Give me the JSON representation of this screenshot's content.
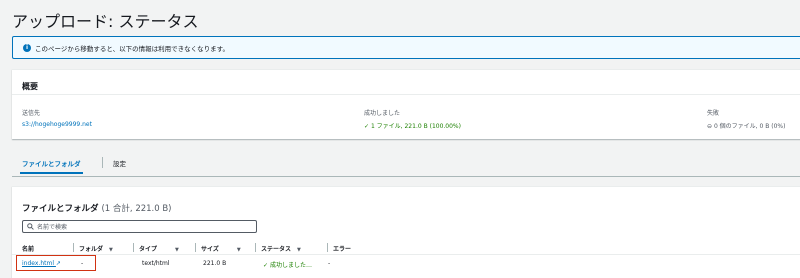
{
  "page": {
    "title": "アップロード: ステータス"
  },
  "info": {
    "message": "このページから移動すると、以下の情報は利用できなくなります。"
  },
  "overview": {
    "heading": "概要",
    "destination": {
      "label": "送信先",
      "value": "s3://hogehoge9999.net"
    },
    "succeeded": {
      "label": "成功しました",
      "value": "1 ファイル, 221.0 B (100.00%)"
    },
    "failed": {
      "label": "失敗",
      "value": "0 個のファイル, 0 B (0%)"
    }
  },
  "tabs": [
    {
      "label": "ファイルとフォルダ",
      "active": true
    },
    {
      "label": "設定",
      "active": false
    }
  ],
  "files": {
    "title": "ファイルとフォルダ",
    "count": "(1 合計, 221.0 B)",
    "search_placeholder": "名前で検索",
    "columns": [
      "名前",
      "フォルダ",
      "タイプ",
      "サイズ",
      "ステータス",
      "エラー"
    ],
    "rows": [
      {
        "name": "index.html",
        "folder": "-",
        "type": "text/html",
        "size": "221.0 B",
        "status": "成功しました",
        "error": "-"
      }
    ]
  },
  "colors": {
    "accent": "#0073bb",
    "success": "#1d8102",
    "highlight": "#d13212"
  }
}
